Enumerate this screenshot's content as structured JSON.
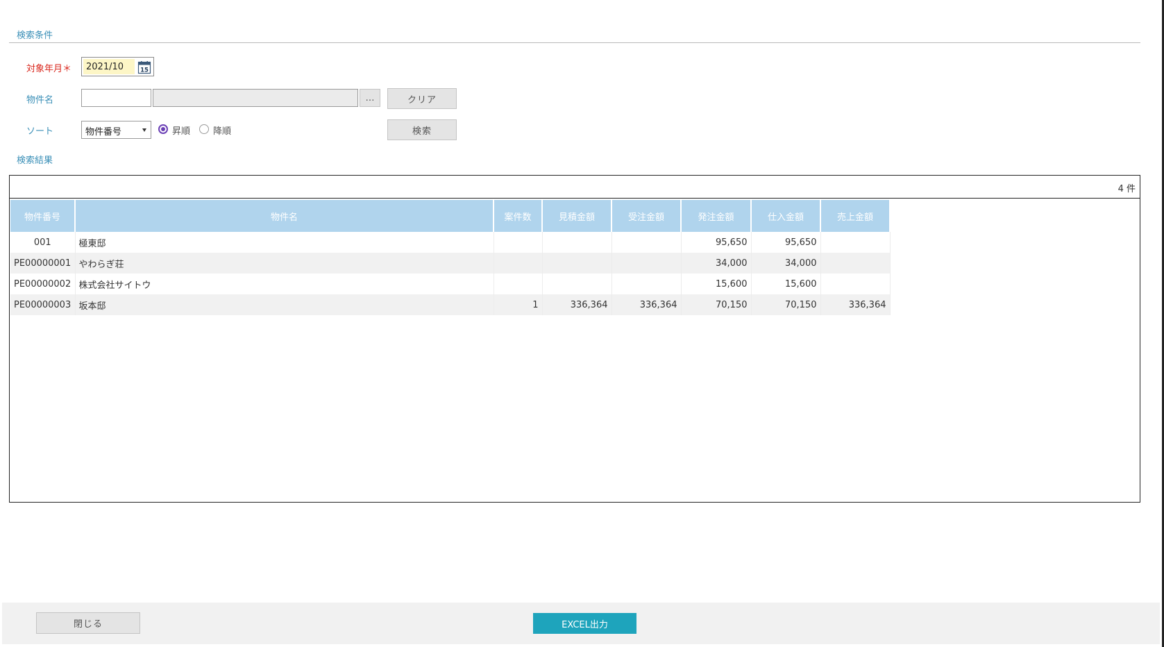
{
  "search_conditions": {
    "title": "検索条件",
    "target_month": {
      "label": "対象年月＊",
      "value": "2021/10"
    },
    "property_name": {
      "label": "物件名",
      "code_value": "",
      "name_value": "",
      "lookup_label": "…"
    },
    "sort": {
      "label": "ソート",
      "selected": "物件番号",
      "asc_label": "昇順",
      "desc_label": "降順",
      "order": "asc"
    },
    "clear_label": "クリア",
    "search_label": "検索"
  },
  "results": {
    "title": "検索結果",
    "count_text": "4 件",
    "columns": [
      "物件番号",
      "物件名",
      "案件数",
      "見積金額",
      "受注金額",
      "発注金額",
      "仕入金額",
      "売上金額"
    ],
    "rows": [
      [
        "001",
        "極東邸",
        "",
        "",
        "",
        "95,650",
        "95,650",
        ""
      ],
      [
        "PE00000001",
        "やわらぎ荘",
        "",
        "",
        "",
        "34,000",
        "34,000",
        ""
      ],
      [
        "PE00000002",
        "株式会社サイトウ",
        "",
        "",
        "",
        "15,600",
        "15,600",
        ""
      ],
      [
        "PE00000003",
        "坂本邸",
        "1",
        "336,364",
        "336,364",
        "70,150",
        "70,150",
        "336,364"
      ]
    ]
  },
  "footer": {
    "close_label": "閉じる",
    "excel_label": "EXCEL出力"
  },
  "colors": {
    "header_bg": "#b0d4ed",
    "excel_button": "#1ea4bc",
    "section_title": "#3a8fb7",
    "required_label": "#d9261c"
  }
}
